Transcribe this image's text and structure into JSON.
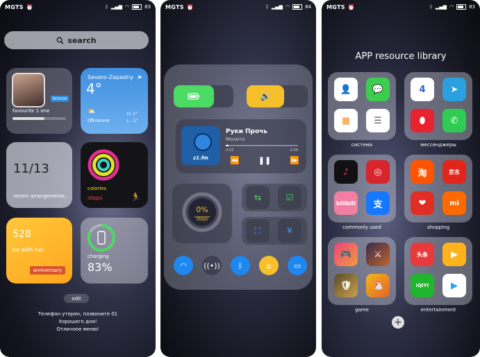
{
  "screen1": {
    "status": {
      "carrier": "MGTS",
      "battery": "83"
    },
    "search": {
      "label": "search"
    },
    "favourite": {
      "badge": "bronze",
      "label": "favourite 1 one",
      "progress": 0.6
    },
    "weather": {
      "city": "Severo-Zapadny",
      "temp": "4°",
      "condition": "Облачно",
      "high": "H: 1°",
      "low": "L: -1°"
    },
    "date_widget": {
      "date": "11/13",
      "label": "recent arrangements.."
    },
    "activity": {
      "calories": "calories",
      "steps": "steps"
    },
    "anniversary": {
      "number": "528",
      "subtitle": "be with her",
      "button": "anniversary"
    },
    "charging": {
      "label": "charging",
      "percent": "83%",
      "level": 0.83
    },
    "edit": {
      "label": "edit"
    },
    "lock_message": [
      "Телефон утерян, позвоните 01",
      "Хорошего дня!",
      "Отличное меню!"
    ]
  },
  "screen2": {
    "status": {
      "carrier": "MGTS",
      "battery": "84"
    },
    "media": {
      "title": "Руки Прочь",
      "artist": "Мохито",
      "elapsed": "0:03",
      "remaining": "-2:56",
      "station": "z1.fm",
      "progress": 0.04
    },
    "steps": {
      "percent": "0%",
      "label": "steps",
      "level": 0
    },
    "colors": {
      "green": "#4cd964",
      "yellow": "#f6c02a",
      "blue": "#1e88f0"
    }
  },
  "screen3": {
    "status": {
      "carrier": "MGTS",
      "battery": "83"
    },
    "title": "APP resource library",
    "folders": [
      {
        "label": "система",
        "icons": [
          "contacts-icon",
          "messages-icon",
          "calculator-icon",
          "notes-icon"
        ]
      },
      {
        "label": "мессенджеры",
        "icons": [
          "4pda-icon",
          "telegram-icon",
          "egg-icon",
          "whatsapp-icon"
        ]
      },
      {
        "label": "commonly used",
        "icons": [
          "tiktok-icon",
          "netease-icon",
          "bilibili-icon",
          "alipay-icon"
        ]
      },
      {
        "label": "shopping",
        "icons": [
          "taobao-icon",
          "jd-icon",
          "pinduoduo-icon",
          "mi-icon"
        ]
      },
      {
        "label": "game",
        "icons": [
          "game-controller-icon",
          "hero-game-icon",
          "warrior-game-icon",
          "chicken-game-icon"
        ]
      },
      {
        "label": "entertainment",
        "icons": [
          "toutiao-icon",
          "video-icon",
          "iqiyi-icon",
          "play-icon"
        ]
      }
    ],
    "app_text": {
      "bilibili": "bilibili",
      "taobao": "淘",
      "jd": "京东",
      "mi": "mi",
      "toutiao": "头条",
      "iqiyi": "iQIYI",
      "alipay": "支"
    }
  }
}
